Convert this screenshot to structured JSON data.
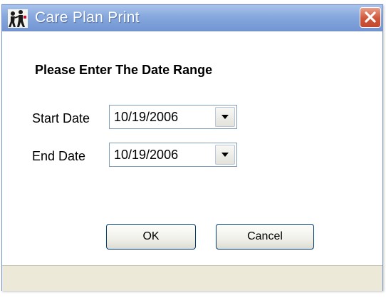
{
  "window": {
    "title": "Care Plan Print",
    "title_color": "#ffffff",
    "titlebar_color": "#86a8de",
    "close_button_color": "#d0553a"
  },
  "icons": {
    "app": "people-icon",
    "close": "close-icon",
    "dropdown": "chevron-down-icon"
  },
  "dialog": {
    "heading": "Please Enter The Date Range",
    "start_date": {
      "label": "Start Date",
      "value": "10/19/2006"
    },
    "end_date": {
      "label": "End Date",
      "value": "10/19/2006"
    },
    "ok_label": "OK",
    "cancel_label": "Cancel"
  }
}
